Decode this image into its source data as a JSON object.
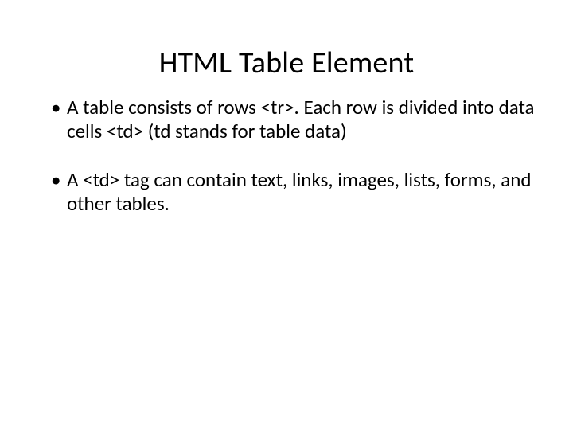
{
  "title": "HTML Table Element",
  "bullets": [
    "A table consists of rows <tr>. Each row is divided into data cells <td> (td stands for table data)",
    "A <td> tag can contain text, links, images, lists, forms, and other tables."
  ]
}
